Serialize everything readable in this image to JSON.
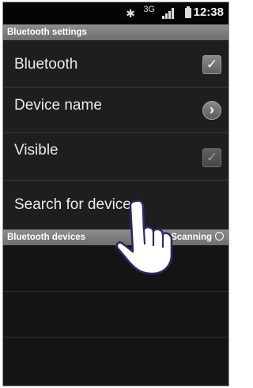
{
  "status_bar": {
    "time": "12:38",
    "network_label": "3G",
    "icons": [
      "bluetooth-icon",
      "network-3g-icon",
      "signal-icon",
      "battery-icon"
    ]
  },
  "settings_header": "Bluetooth settings",
  "rows": {
    "bluetooth": {
      "label": "Bluetooth",
      "checked": true
    },
    "device_name": {
      "label": "Device name"
    },
    "visible": {
      "label": "Visible",
      "checked": true
    },
    "search": {
      "label": "Search for devices"
    }
  },
  "devices_header": {
    "label": "Bluetooth devices",
    "status": "Scanning"
  },
  "glyphs": {
    "check": "✓",
    "chevron": "›",
    "bluetooth": "✱"
  },
  "colors": {
    "background": "#1a1a1a",
    "header": "#7e7e7e",
    "text": "#ebebeb"
  }
}
